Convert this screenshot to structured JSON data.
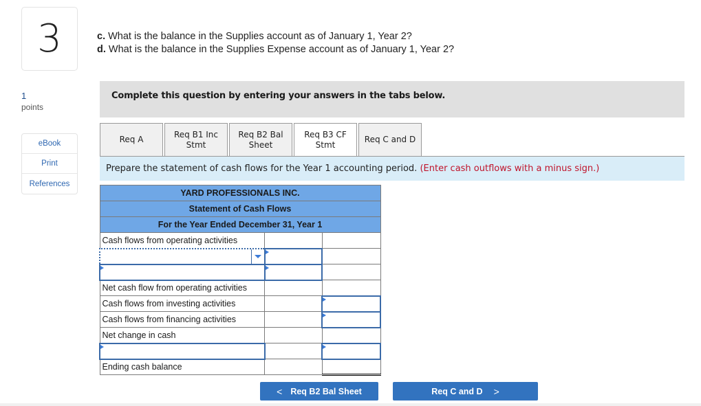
{
  "question_number": "3",
  "questions": [
    {
      "label": "c.",
      "text": " What is the balance in the Supplies account as of January 1, Year 2?"
    },
    {
      "label": "d.",
      "text": " What is the balance in the Supplies Expense account as of January 1, Year 2?"
    }
  ],
  "points": {
    "value": "1",
    "label": "points"
  },
  "side_menu": [
    "eBook",
    "Print",
    "References"
  ],
  "instruction": "Complete this question by entering your answers in the tabs below.",
  "tabs": [
    {
      "label": "Req A",
      "active": false
    },
    {
      "label": "Req B1 Inc\nStmt",
      "active": false
    },
    {
      "label": "Req B2 Bal\nSheet",
      "active": false
    },
    {
      "label": "Req B3 CF\nStmt",
      "active": true
    },
    {
      "label": "Req C and D",
      "active": false
    }
  ],
  "prompt": {
    "text": "Prepare the statement of cash flows for the Year 1 accounting period. ",
    "note": "(Enter cash outflows with a minus sign.)"
  },
  "statement": {
    "company": "YARD PROFESSIONALS INC.",
    "title": "Statement of Cash Flows",
    "period": "For the Year Ended December 31, Year 1",
    "rows": {
      "operating_header": "Cash flows from operating activities",
      "operating_select_value": "",
      "operating_line2_value": "",
      "net_operating": "Net cash flow from operating activities",
      "investing": "Cash flows from investing activities",
      "financing": "Cash flows from financing activities",
      "net_change": "Net change in cash",
      "beginning_label_value": "",
      "ending": "Ending cash balance"
    }
  },
  "nav": {
    "prev_label": "Req B2 Bal Sheet",
    "next_label": "Req C and D",
    "prev_icon": "<",
    "next_icon": ">"
  }
}
